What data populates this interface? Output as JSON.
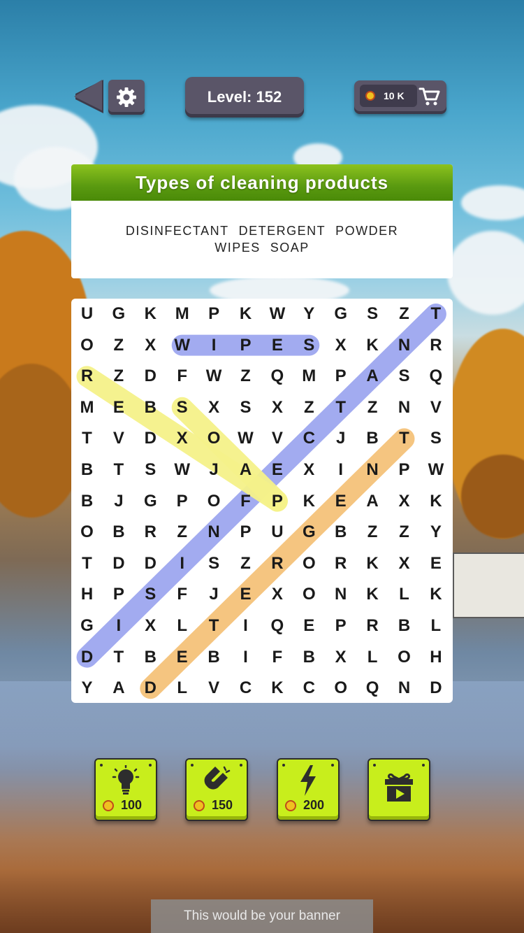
{
  "header": {
    "level_label": "Level: 152",
    "coins": "10 K"
  },
  "category": {
    "title": "Types of cleaning products",
    "words_line1": [
      "DISINFECTANT",
      "DETERGENT",
      "POWDER"
    ],
    "words_line2": [
      "WIPES",
      "SOAP"
    ]
  },
  "grid": {
    "rows": [
      [
        "U",
        "G",
        "K",
        "M",
        "P",
        "K",
        "W",
        "Y",
        "G",
        "S",
        "Z",
        "T"
      ],
      [
        "O",
        "Z",
        "X",
        "W",
        "I",
        "P",
        "E",
        "S",
        "X",
        "K",
        "N",
        "R"
      ],
      [
        "R",
        "Z",
        "D",
        "F",
        "W",
        "Z",
        "Q",
        "M",
        "P",
        "A",
        "S",
        "Q"
      ],
      [
        "M",
        "E",
        "B",
        "S",
        "X",
        "S",
        "X",
        "Z",
        "T",
        "Z",
        "N",
        "V"
      ],
      [
        "T",
        "V",
        "D",
        "X",
        "O",
        "W",
        "V",
        "C",
        "J",
        "B",
        "T",
        "S"
      ],
      [
        "B",
        "T",
        "S",
        "W",
        "J",
        "A",
        "E",
        "X",
        "I",
        "N",
        "P",
        "W"
      ],
      [
        "B",
        "J",
        "G",
        "P",
        "O",
        "F",
        "P",
        "K",
        "E",
        "A",
        "X",
        "K"
      ],
      [
        "O",
        "B",
        "R",
        "Z",
        "N",
        "P",
        "U",
        "G",
        "B",
        "Z",
        "Z",
        "Y"
      ],
      [
        "T",
        "D",
        "D",
        "I",
        "S",
        "Z",
        "R",
        "O",
        "R",
        "K",
        "X",
        "E"
      ],
      [
        "H",
        "P",
        "S",
        "F",
        "J",
        "E",
        "X",
        "O",
        "N",
        "K",
        "L",
        "K"
      ],
      [
        "G",
        "I",
        "X",
        "L",
        "T",
        "I",
        "Q",
        "E",
        "P",
        "R",
        "B",
        "L"
      ],
      [
        "D",
        "T",
        "B",
        "E",
        "B",
        "I",
        "F",
        "B",
        "X",
        "L",
        "O",
        "H"
      ],
      [
        "Y",
        "A",
        "D",
        "L",
        "V",
        "C",
        "K",
        "C",
        "O",
        "Q",
        "N",
        "D"
      ]
    ],
    "found": [
      {
        "word": "WIPES",
        "from": [
          1,
          3
        ],
        "to": [
          1,
          7
        ],
        "color": "#9ea7f0"
      },
      {
        "word": "DISINFECTANT",
        "from": [
          11,
          0
        ],
        "to": [
          0,
          11
        ],
        "color": "#9ea7f0"
      },
      {
        "word": "DETERGENT",
        "from": [
          12,
          2
        ],
        "to": [
          4,
          10
        ],
        "color": "#f5c27a"
      },
      {
        "word": "POWDER",
        "from": [
          6,
          6
        ],
        "to": [
          2,
          0
        ],
        "color": "#f5f28a"
      },
      {
        "word": "SOAP",
        "from": [
          3,
          3
        ],
        "to": [
          6,
          6
        ],
        "color": "#f5f28a"
      }
    ]
  },
  "powerups": [
    {
      "name": "hint",
      "icon": "lightbulb-icon",
      "cost": "100"
    },
    {
      "name": "magnet",
      "icon": "magnet-icon",
      "cost": "150"
    },
    {
      "name": "lightning",
      "icon": "lightning-icon",
      "cost": "200"
    },
    {
      "name": "reward-video",
      "icon": "gift-video-icon",
      "cost": ""
    }
  ],
  "banner_text": "This would be your banner"
}
